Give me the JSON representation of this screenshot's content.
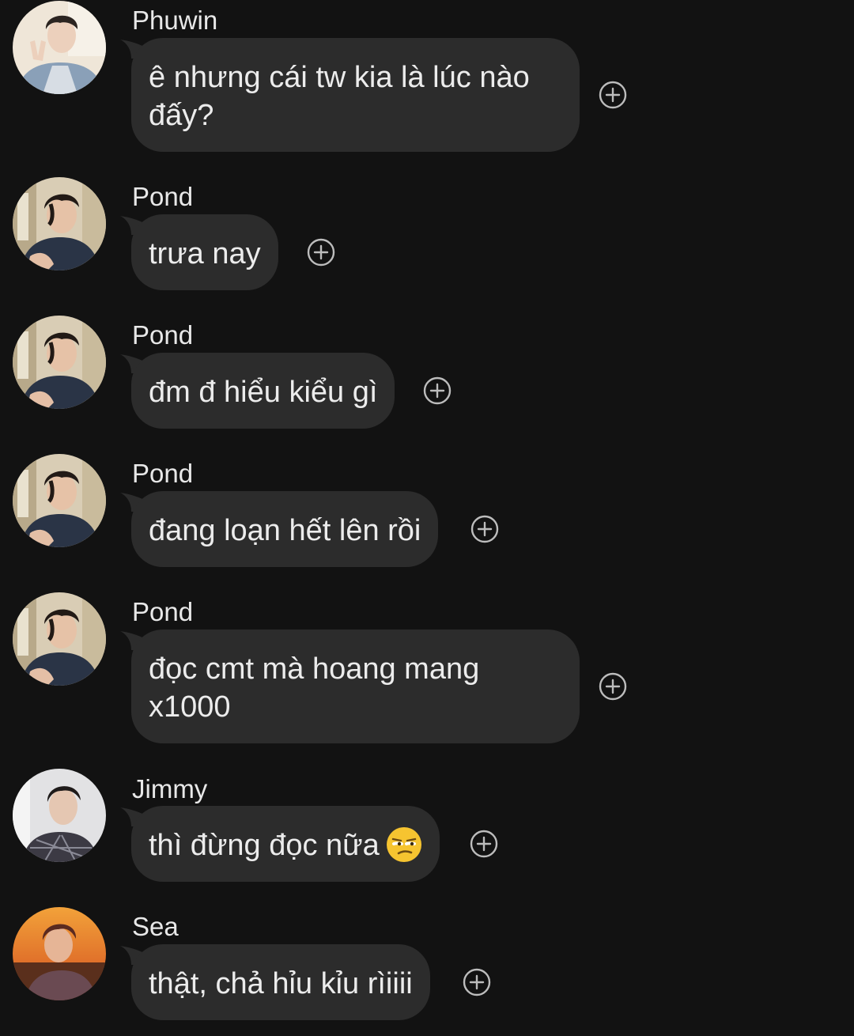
{
  "messages": [
    {
      "sender": "Phuwin",
      "text": "ê nhưng cái tw kia là lúc nào đấy?",
      "avatar": "phuwin-avatar"
    },
    {
      "sender": "Pond",
      "text": "trưa nay",
      "avatar": "pond-avatar"
    },
    {
      "sender": "Pond",
      "text": "đm đ hiểu kiểu gì",
      "avatar": "pond-avatar"
    },
    {
      "sender": "Pond",
      "text": "đang loạn hết lên rồi",
      "avatar": "pond-avatar"
    },
    {
      "sender": "Pond",
      "text": "đọc cmt mà hoang mang x1000",
      "avatar": "pond-avatar"
    },
    {
      "sender": "Jimmy",
      "text": "thì đừng đọc nữa",
      "emoji": "unamused-face-emoji",
      "avatar": "jimmy-avatar"
    },
    {
      "sender": "Sea",
      "text": "thật, chả hỉu kỉu rìiiii",
      "avatar": "sea-avatar"
    }
  ],
  "icons": {
    "add_reaction": "plus-circle-icon"
  },
  "colors": {
    "background": "#121212",
    "bubble": "#2c2c2c",
    "text": "#ececec",
    "icon": "#bdbdbd"
  }
}
